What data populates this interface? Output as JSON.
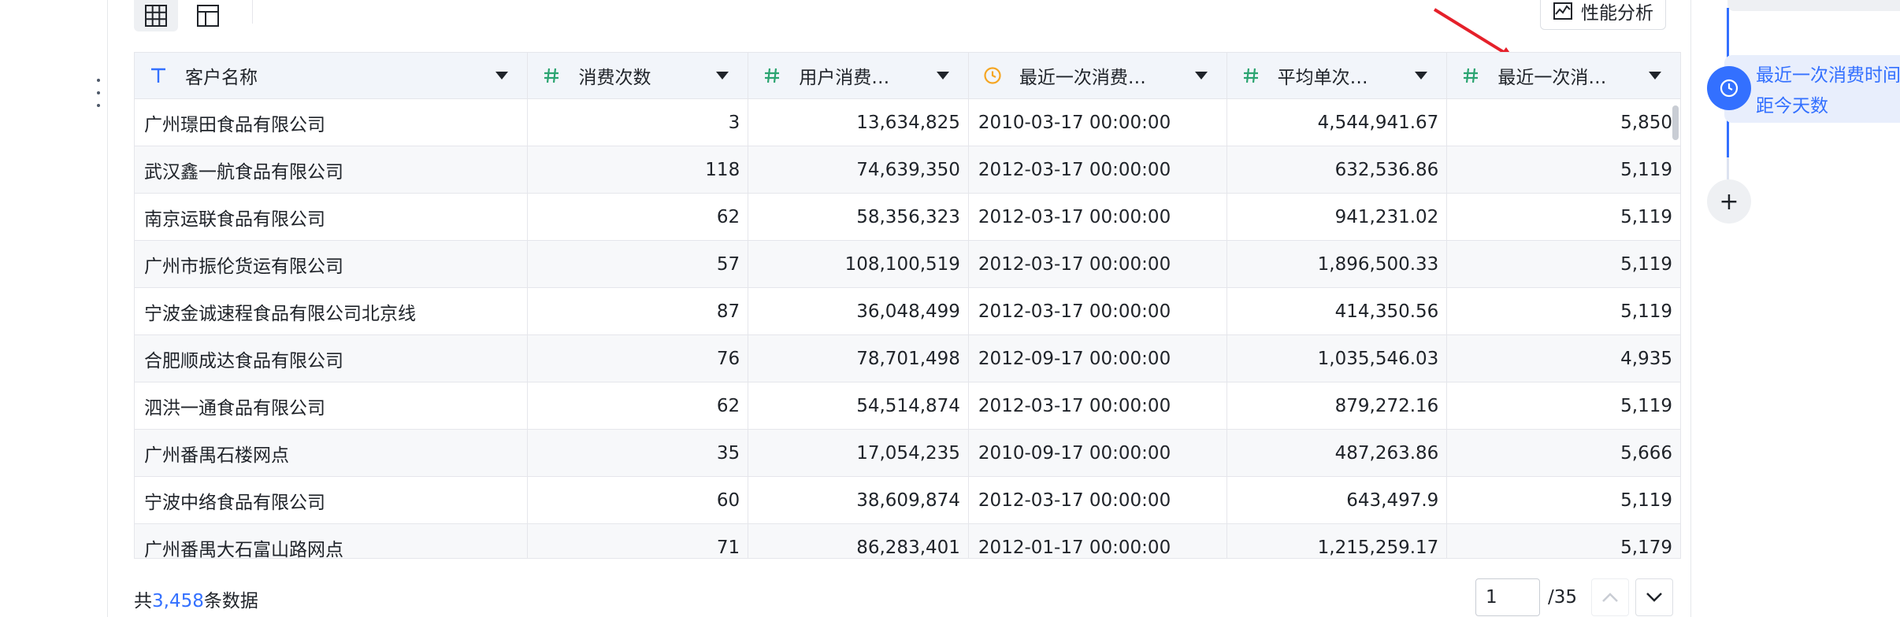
{
  "toolbar": {
    "views": [
      {
        "icon": "grid-table-icon",
        "active": true
      },
      {
        "icon": "layout-icon",
        "active": false
      }
    ],
    "perf_label": "性能分析"
  },
  "table": {
    "columns": [
      {
        "label": "客户名称",
        "type": "text",
        "icon": "text-type-icon",
        "color": "#3370ff"
      },
      {
        "label": "消费次数",
        "type": "number",
        "icon": "number-type-icon",
        "color": "#2ba471"
      },
      {
        "label": "用户消费…",
        "type": "number",
        "icon": "number-type-icon",
        "color": "#2ba471"
      },
      {
        "label": "最近一次消费…",
        "type": "datetime",
        "icon": "clock-type-icon",
        "color": "#f5a623"
      },
      {
        "label": "平均单次…",
        "type": "number",
        "icon": "number-type-icon",
        "color": "#2ba471"
      },
      {
        "label": "最近一次消…",
        "type": "number",
        "icon": "number-type-icon",
        "color": "#2ba471"
      }
    ],
    "rows": [
      [
        "广州璟田食品有限公司",
        "3",
        "13,634,825",
        "2010-03-17 00:00:00",
        "4,544,941.67",
        "5,850"
      ],
      [
        "武汉鑫一航食品有限公司",
        "118",
        "74,639,350",
        "2012-03-17 00:00:00",
        "632,536.86",
        "5,119"
      ],
      [
        "南京运联食品有限公司",
        "62",
        "58,356,323",
        "2012-03-17 00:00:00",
        "941,231.02",
        "5,119"
      ],
      [
        "广州市振伦货运有限公司",
        "57",
        "108,100,519",
        "2012-03-17 00:00:00",
        "1,896,500.33",
        "5,119"
      ],
      [
        "宁波金诚速程食品有限公司北京线",
        "87",
        "36,048,499",
        "2012-03-17 00:00:00",
        "414,350.56",
        "5,119"
      ],
      [
        "合肥顺成达食品有限公司",
        "76",
        "78,701,498",
        "2012-09-17 00:00:00",
        "1,035,546.03",
        "4,935"
      ],
      [
        "泗洪一通食品有限公司",
        "62",
        "54,514,874",
        "2012-03-17 00:00:00",
        "879,272.16",
        "5,119"
      ],
      [
        "广州番禺石楼网点",
        "35",
        "17,054,235",
        "2010-09-17 00:00:00",
        "487,263.86",
        "5,666"
      ],
      [
        "宁波中络食品有限公司",
        "60",
        "38,609,874",
        "2012-03-17 00:00:00",
        "643,497.9",
        "5,119"
      ],
      [
        "广州番禺大石富山路网点",
        "71",
        "86,283,401",
        "2012-01-17 00:00:00",
        "1,215,259.17",
        "5,179"
      ]
    ]
  },
  "footer": {
    "prefix": "共",
    "count": "3,458",
    "suffix": "条数据",
    "page_value": "1",
    "page_total": "/35"
  },
  "right_panel": {
    "node_label_line1": "最近一次消费时间",
    "node_label_line2": "距今天数",
    "add_symbol": "+"
  },
  "colors": {
    "accent": "#3370ff",
    "number_icon": "#2ba471",
    "time_icon": "#f5a623",
    "arrow": "#e5202a"
  }
}
